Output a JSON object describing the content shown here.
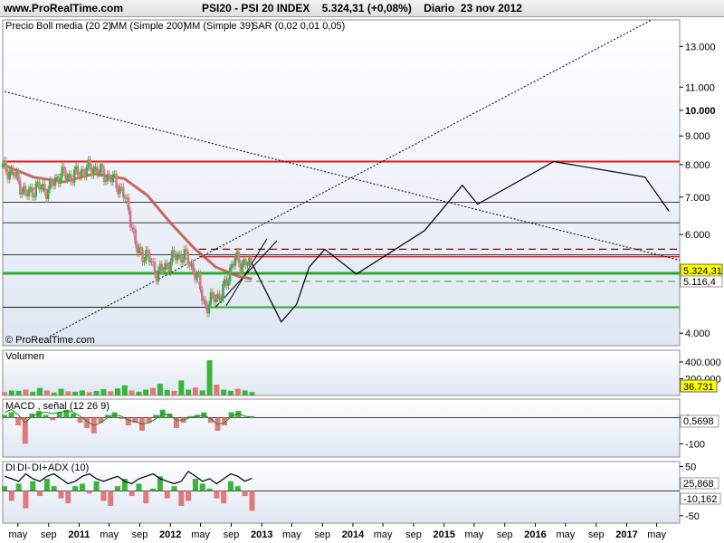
{
  "header": {
    "site": "www.ProRealTime.com",
    "symbol": "PSI20 - PSI 20 INDEX",
    "last": "5.324,31 (+0,08%)",
    "period": "Diario",
    "date": "23 nov 2012"
  },
  "legend": {
    "price": "Precio",
    "boll": "Boll media (20 2)",
    "mm200": "MM (Simple 200)",
    "mm39": "MM (Simple 39)",
    "sar": "SAR (0,02 0,01 0,05)"
  },
  "watermark": "© ProRealTime.com",
  "colors": {
    "price_up": "#3cb43c",
    "price_down": "#e07a7a",
    "boll": "#9b59d0",
    "mm200": "#c0504d",
    "mm39": "#d96060",
    "support": "#2eab2e",
    "resistance": "#e8171d",
    "tag_last": "#ffff00",
    "adx": "#000000"
  },
  "chart_data": [
    {
      "type": "line",
      "panel": "price",
      "y_scale": "log",
      "ylim": [
        3.8,
        14.5
      ],
      "y_ticks": [
        "13.000",
        "11.000",
        "10.000",
        "9.000",
        "8.000",
        "7.000",
        "6.000",
        "5.000",
        "4.000"
      ],
      "y_tick_values": [
        13000,
        11000,
        10000,
        9000,
        8000,
        7000,
        6000,
        5000,
        4000
      ],
      "x_tick_labels": [
        "may",
        "sep",
        "2011",
        "may",
        "sep",
        "2012",
        "may",
        "sep",
        "2013",
        "may",
        "sep",
        "2014",
        "may",
        "sep",
        "2015",
        "may",
        "sep",
        "2016",
        "may",
        "sep",
        "2017",
        "may"
      ],
      "x_tick_dates": [
        "2010-05",
        "2010-09",
        "2011-01",
        "2011-05",
        "2011-09",
        "2012-01",
        "2012-05",
        "2012-09",
        "2013-01",
        "2013-05",
        "2013-09",
        "2014-01",
        "2014-05",
        "2014-09",
        "2015-01",
        "2015-05",
        "2015-09",
        "2016-01",
        "2016-05",
        "2016-09",
        "2017-01",
        "2017-05"
      ],
      "price_series": {
        "name": "Precio",
        "x": [
          "2010-03-01",
          "2010-04-15",
          "2010-06-01",
          "2010-07-15",
          "2010-09-01",
          "2010-10-15",
          "2010-12-01",
          "2011-01-15",
          "2011-03-01",
          "2011-04-15",
          "2011-05-20",
          "2011-06-20",
          "2011-07-20",
          "2011-08-20",
          "2011-10-01",
          "2011-11-10",
          "2011-12-20",
          "2012-01-20",
          "2012-02-25",
          "2012-03-25",
          "2012-04-25",
          "2012-05-25",
          "2012-06-25",
          "2012-07-20",
          "2012-08-20",
          "2012-09-20",
          "2012-10-20",
          "2012-11-23"
        ],
        "values": [
          7900,
          7700,
          7050,
          7300,
          7200,
          7700,
          7600,
          7800,
          7900,
          7650,
          7500,
          7200,
          6600,
          5600,
          5500,
          5100,
          5300,
          5500,
          5500,
          5300,
          4900,
          4400,
          4700,
          4600,
          5100,
          5450,
          5300,
          5324
        ]
      },
      "sma200": {
        "name": "MM (Simple 200)",
        "x": [
          "2010-03-01",
          "2010-07-01",
          "2010-11-01",
          "2011-03-01",
          "2011-07-01",
          "2011-10-01",
          "2012-01-01",
          "2012-04-01",
          "2012-07-01",
          "2012-10-01",
          "2012-11-23"
        ],
        "values": [
          8000,
          7600,
          7450,
          7700,
          7550,
          7050,
          6300,
          5700,
          5250,
          5050,
          5000
        ]
      },
      "drawn_lines": {
        "resistance_high": 8100,
        "levels_black": [
          6850,
          6300,
          5520,
          4450
        ],
        "resistance_mid": 5480,
        "support_main": 5116.4,
        "support_low": 4450,
        "support_dashed": 4950,
        "projection": {
          "x": [
            "2012-11-23",
            "2013-03-20",
            "2013-05-20",
            "2013-07-10",
            "2013-09-10",
            "2014-01-15",
            "2014-10-15",
            "2015-03-15",
            "2015-05-15",
            "2016-03-15",
            "2017-03-15",
            "2017-06-20"
          ],
          "values": [
            5324,
            4190,
            4500,
            5250,
            5650,
            5100,
            6100,
            7350,
            6800,
            8100,
            7600,
            6600
          ]
        }
      },
      "tags": {
        "last": "5.324,31",
        "support": "5.116,4"
      }
    },
    {
      "type": "bar",
      "panel": "volume",
      "title": "Volumen",
      "y_ticks": [
        "400.000",
        "200.000"
      ],
      "y_tick_values": [
        400000,
        200000
      ],
      "ylim": [
        0,
        540000
      ],
      "last_value": "36.731",
      "values": [
        40000,
        60000,
        55000,
        70000,
        45000,
        90000,
        60000,
        35000,
        80000,
        50000,
        45000,
        60000,
        40000,
        55000,
        75000,
        50000,
        85000,
        120000,
        60000,
        45000,
        70000,
        90000,
        140000,
        65000,
        55000,
        180000,
        70000,
        95000,
        60000,
        420000,
        130000,
        70000,
        55000,
        80000,
        60000,
        40000
      ]
    },
    {
      "type": "line",
      "panel": "macd",
      "title": "MACD , señal (12 26 9)",
      "y_ticks": [
        "0",
        "-100"
      ],
      "y_tick_values": [
        0,
        -100
      ],
      "ylim": [
        -150,
        70
      ],
      "last_value": "0,5698",
      "histogram": [
        10,
        20,
        -30,
        -100,
        15,
        25,
        10,
        -10,
        20,
        30,
        15,
        -20,
        -40,
        -60,
        -20,
        10,
        20,
        -5,
        -30,
        -20,
        -50,
        -20,
        10,
        30,
        15,
        -40,
        -20,
        5,
        10,
        20,
        -20,
        -50,
        -30,
        20,
        25,
        0,
        5
      ],
      "macd_line": [
        20,
        30,
        10,
        -20,
        5,
        15,
        20,
        15,
        20,
        25,
        20,
        5,
        -15,
        -30,
        -20,
        0,
        10,
        5,
        -10,
        -15,
        -25,
        -20,
        -5,
        15,
        10,
        -10,
        -10,
        0,
        5,
        10,
        -5,
        -25,
        -20,
        5,
        15,
        5,
        1
      ]
    },
    {
      "type": "line",
      "panel": "adx",
      "title": "ADX (10)",
      "legend_labels": [
        "DI",
        "DI-",
        "DI+"
      ],
      "y_ticks": [
        "50",
        "-50"
      ],
      "y_tick_values": [
        50,
        -50
      ],
      "ylim": [
        -65,
        60
      ],
      "last_values": [
        "25,868",
        "-10,162"
      ],
      "histogram": [
        10,
        -20,
        15,
        -35,
        20,
        -10,
        25,
        10,
        -15,
        -25,
        10,
        15,
        -5,
        20,
        -20,
        -30,
        10,
        25,
        -10,
        15,
        -25,
        5,
        30,
        -15,
        10,
        -30,
        -20,
        25,
        15,
        5,
        -15,
        -25,
        20,
        10,
        -10,
        -40
      ],
      "adx_line": [
        30,
        25,
        20,
        35,
        25,
        20,
        30,
        35,
        25,
        15,
        20,
        30,
        35,
        25,
        20,
        25,
        30,
        20,
        15,
        25,
        30,
        35,
        25,
        20,
        15,
        20,
        40,
        30,
        20,
        25,
        15,
        25,
        35,
        30,
        20,
        26
      ]
    }
  ]
}
